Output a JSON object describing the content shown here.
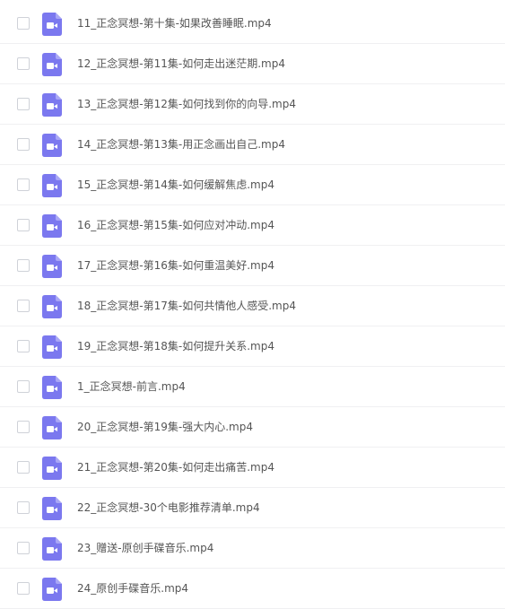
{
  "file_icon": {
    "type": "video-file-icon",
    "color": "#7b78ef",
    "fold_color": "#a9a7f6"
  },
  "files": [
    {
      "name": "11_正念冥想-第十集-如果改善睡眠.mp4"
    },
    {
      "name": "12_正念冥想-第11集-如何走出迷茫期.mp4"
    },
    {
      "name": "13_正念冥想-第12集-如何找到你的向导.mp4"
    },
    {
      "name": "14_正念冥想-第13集-用正念画出自己.mp4"
    },
    {
      "name": "15_正念冥想-第14集-如何缓解焦虑.mp4"
    },
    {
      "name": "16_正念冥想-第15集-如何应对冲动.mp4"
    },
    {
      "name": "17_正念冥想-第16集-如何重温美好.mp4"
    },
    {
      "name": "18_正念冥想-第17集-如何共情他人感受.mp4"
    },
    {
      "name": "19_正念冥想-第18集-如何提升关系.mp4"
    },
    {
      "name": "1_正念冥想-前言.mp4"
    },
    {
      "name": "20_正念冥想-第19集-强大内心.mp4"
    },
    {
      "name": "21_正念冥想-第20集-如何走出痛苦.mp4"
    },
    {
      "name": "22_正念冥想-30个电影推荐清单.mp4"
    },
    {
      "name": "23_赠送-原创手碟音乐.mp4"
    },
    {
      "name": "24_原创手碟音乐.mp4"
    }
  ]
}
